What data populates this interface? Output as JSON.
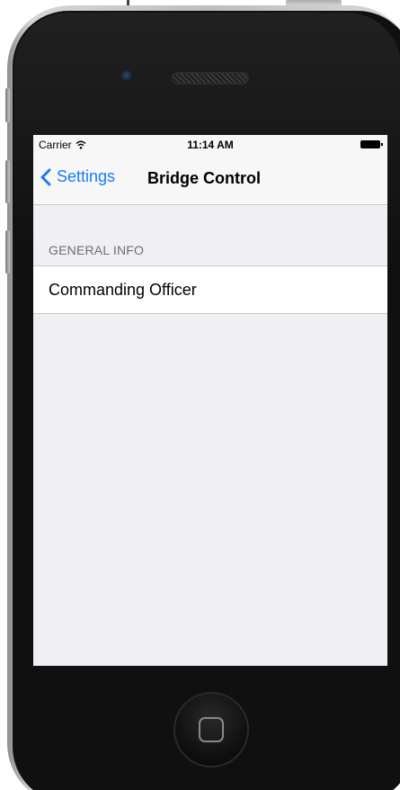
{
  "status_bar": {
    "carrier": "Carrier",
    "time": "11:14 AM"
  },
  "nav_bar": {
    "back_label": "Settings",
    "title": "Bridge Control"
  },
  "section": {
    "header": "GENERAL INFO",
    "rows": [
      {
        "label": "Commanding Officer"
      }
    ]
  },
  "colors": {
    "tint": "#1a7cf5",
    "group_background": "#efeff4",
    "section_header_text": "#6d6d72",
    "separator": "#c8c7cc"
  },
  "icons": [
    "wifi-icon",
    "battery-icon",
    "back-chevron-icon",
    "home-button-icon"
  ]
}
